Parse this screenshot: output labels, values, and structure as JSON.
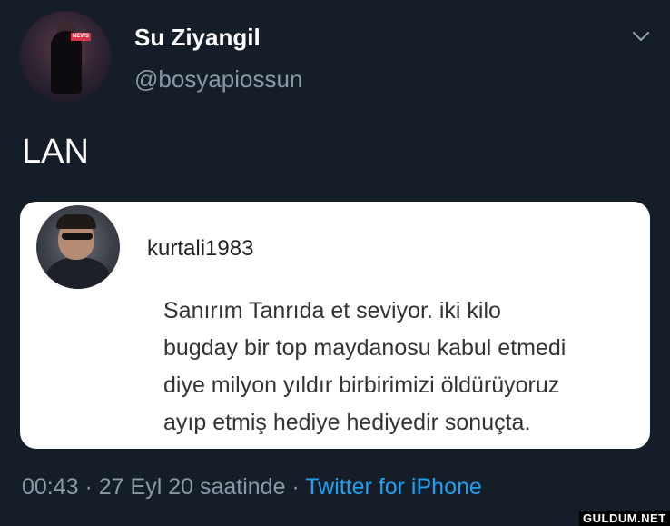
{
  "author": {
    "display_name": "Su Ziyangil",
    "handle": "@bosyapiossun",
    "avatar_badge": "NEWS"
  },
  "tweet": {
    "text": "LAN"
  },
  "quoted": {
    "username": "kurtali1983",
    "lines": [
      "Sanırım Tanrıda et seviyor. iki kilo",
      "bugday bir top maydanosu kabul etmedi",
      "diye milyon yıldır birbirimizi öldürüyoruz",
      "ayıp etmiş hediye hediyedir sonuçta."
    ]
  },
  "meta": {
    "time": "00:43",
    "separator": " · ",
    "date": "27 Eyl 20 saatinde",
    "separator2": " · ",
    "source": "Twitter for iPhone"
  },
  "watermark": "GULDUM.NET",
  "icons": {
    "menu": "chevron-down-icon"
  },
  "colors": {
    "background": "#151d29",
    "secondary_text": "#8899a6",
    "link": "#1da1f2",
    "card": "#ffffff"
  }
}
